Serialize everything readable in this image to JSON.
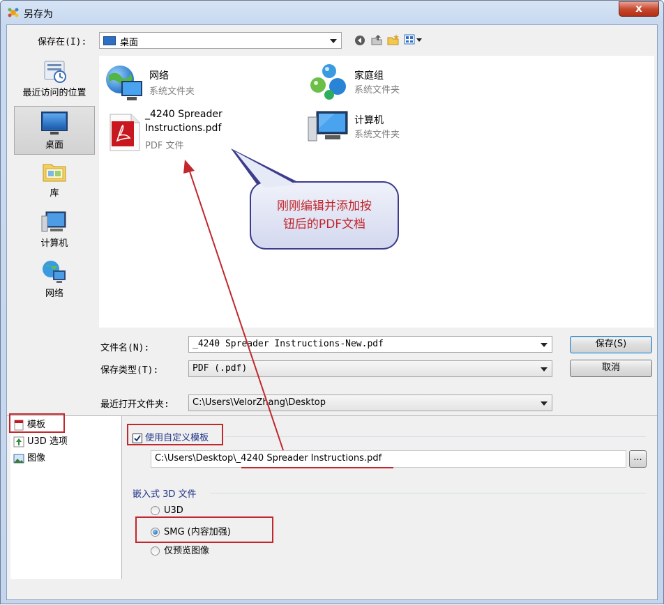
{
  "window": {
    "title": "另存为",
    "close_symbol": "x"
  },
  "toolbar": {
    "save_in_label": "保存在(I):",
    "save_in_value": "桌面"
  },
  "places": [
    {
      "label": "最近访问的位置",
      "icon": "recent-places-icon"
    },
    {
      "label": "桌面",
      "icon": "desktop-icon",
      "active": true
    },
    {
      "label": "库",
      "icon": "libraries-icon"
    },
    {
      "label": "计算机",
      "icon": "computer-icon"
    },
    {
      "label": "网络",
      "icon": "network-icon"
    }
  ],
  "files": [
    {
      "name": "网络",
      "type": "系统文件夹",
      "icon": "network-icon"
    },
    {
      "name": "家庭组",
      "type": "系统文件夹",
      "icon": "homegroup-icon"
    },
    {
      "name_line1": "_4240 Spreader",
      "name_line2": "Instructions.pdf",
      "type": "PDF 文件",
      "icon": "pdf-file-icon"
    },
    {
      "name": "计算机",
      "type": "系统文件夹",
      "icon": "computer-icon"
    }
  ],
  "form": {
    "filename_label": "文件名(N):",
    "filename_value": "_4240 Spreader Instructions-New.pdf",
    "filetype_label": "保存类型(T):",
    "filetype_value": "PDF (.pdf)",
    "recent_label": "最近打开文件夹:",
    "recent_value": "C:\\Users\\VelorZhang\\Desktop",
    "save_button": "保存(S)",
    "cancel_button": "取消"
  },
  "lower": {
    "nav": [
      {
        "label": "模板",
        "icon": "template-icon"
      },
      {
        "label": "U3D 选项",
        "icon": "u3d-icon"
      },
      {
        "label": "图像",
        "icon": "image-icon"
      }
    ],
    "custom_template_label": "使用自定义模板",
    "custom_template_checked": true,
    "template_path": "C:\\Users\\Desktop\\_4240 Spreader Instructions.pdf",
    "browse_button": "...",
    "embedded_title": "嵌入式 3D 文件",
    "radios": [
      {
        "label": "U3D",
        "checked": false
      },
      {
        "label": "SMG (内容加强)",
        "checked": true
      },
      {
        "label": "仅预览图像",
        "checked": false
      }
    ]
  },
  "annotation": {
    "callout_line1": "刚刚编辑并添加按",
    "callout_line2": "钮后的PDF文档"
  },
  "colors": {
    "annotation_red": "#c1272d",
    "callout_fill": "#e6e9f6",
    "callout_border": "#3c3c8c"
  }
}
